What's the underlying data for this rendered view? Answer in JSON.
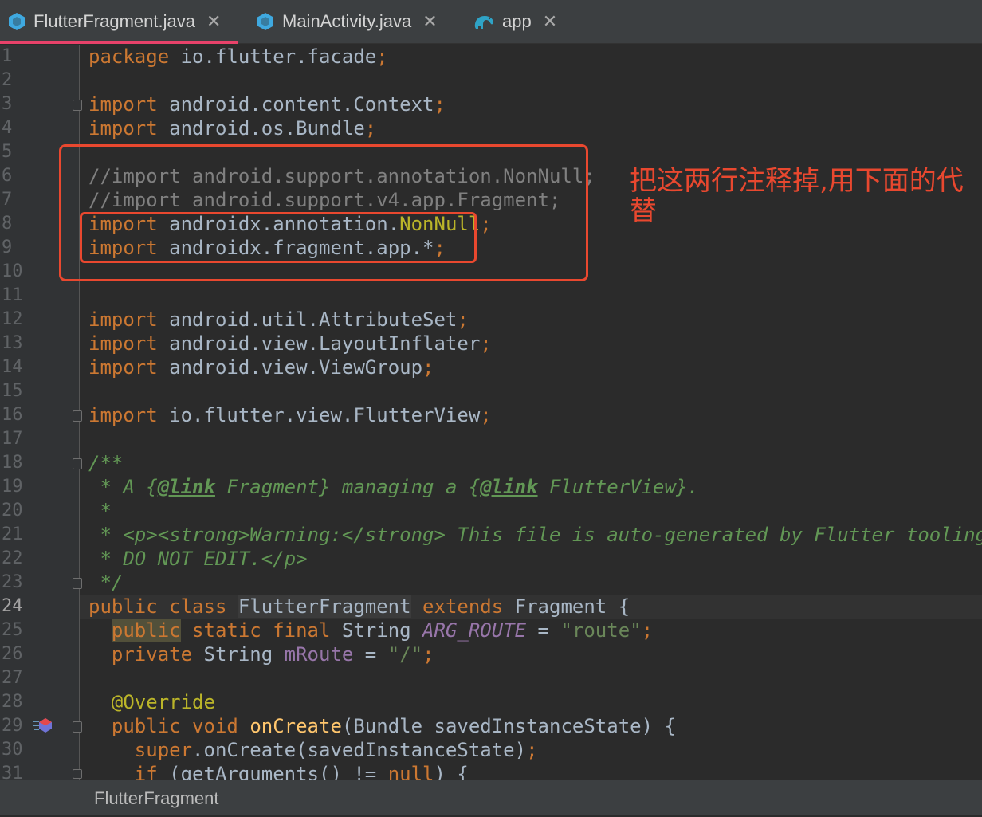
{
  "tabs": [
    {
      "label": "FlutterFragment.java",
      "icon": "java-class-icon",
      "active": true
    },
    {
      "label": "MainActivity.java",
      "icon": "java-class-icon",
      "active": false
    },
    {
      "label": "app",
      "icon": "gradle-elephant-icon",
      "active": false
    }
  ],
  "tab_close_glyph": "✕",
  "line_numbers": [
    "1",
    "2",
    "3",
    "4",
    "5",
    "6",
    "7",
    "8",
    "9",
    "10",
    "11",
    "12",
    "13",
    "14",
    "15",
    "16",
    "17",
    "18",
    "19",
    "20",
    "21",
    "22",
    "23",
    "24",
    "25",
    "26",
    "27",
    "28",
    "29",
    "30",
    "31"
  ],
  "current_line": "24",
  "code": {
    "l1": {
      "a": "package",
      "b": " io.flutter.facade",
      "c": ";"
    },
    "l3": {
      "a": "import",
      "b": " android.content.Context",
      "c": ";"
    },
    "l4": {
      "a": "import",
      "b": " android.os.Bundle",
      "c": ";"
    },
    "l6": "//import android.support.annotation.NonNull;",
    "l7": "//import android.support.v4.app.Fragment;",
    "l8": {
      "a": "import",
      "b": " androidx.annotation.",
      "c": "NonNull",
      "d": ";"
    },
    "l9": {
      "a": "import",
      "b": " androidx.fragment.app.*",
      "c": ";"
    },
    "l12": {
      "a": "import",
      "b": " android.util.AttributeSet",
      "c": ";"
    },
    "l13": {
      "a": "import",
      "b": " android.view.LayoutInflater",
      "c": ";"
    },
    "l14": {
      "a": "import",
      "b": " android.view.ViewGroup",
      "c": ";"
    },
    "l16": {
      "a": "import",
      "b": " io.flutter.view.FlutterView",
      "c": ";"
    },
    "l18": "/**",
    "l19": {
      "a": " * A {",
      "b": "@link",
      "c": " Fragment} managing a {",
      "d": "@link",
      "e": " FlutterView}."
    },
    "l20": " *",
    "l21": " * <p><strong>Warning:</strong> This file is auto-generated by Flutter tooling.",
    "l22": " * DO NOT EDIT.</p>",
    "l23": " */",
    "l24": {
      "a": "public class",
      "b": " ",
      "c": "FlutterFragment",
      "d": " ",
      "e": "extends",
      "f": " Fragment {"
    },
    "l25": {
      "a": "  ",
      "b": "public",
      "c": " static final",
      "d": " String ",
      "e": "ARG_ROUTE",
      "f": " = ",
      "g": "\"route\"",
      "h": ";"
    },
    "l26": {
      "a": "  ",
      "b": "private",
      "c": " String ",
      "d": "mRoute",
      "e": " = ",
      "f": "\"/\"",
      "g": ";"
    },
    "l28": {
      "a": "  ",
      "b": "@Override"
    },
    "l29": {
      "a": "  ",
      "b": "public void",
      "c": " ",
      "d": "onCreate",
      "e": "(Bundle savedInstanceState) {"
    },
    "l30": {
      "a": "    ",
      "b": "super",
      "c": ".onCreate(savedInstanceState)",
      "d": ";"
    },
    "l31": {
      "a": "    ",
      "b": "if",
      "c": " (getArguments() != ",
      "d": "null",
      "e": ") {"
    }
  },
  "annotation_note": "把这两行注释掉,用下面的代替",
  "breadcrumb": "FlutterFragment",
  "colors": {
    "editor_bg": "#2b2b2b",
    "keyword": "#cc7832",
    "comment": "#808080",
    "doc": "#629755",
    "annotation_box": "#e9482f",
    "active_tab_underline": "#e8426a"
  }
}
